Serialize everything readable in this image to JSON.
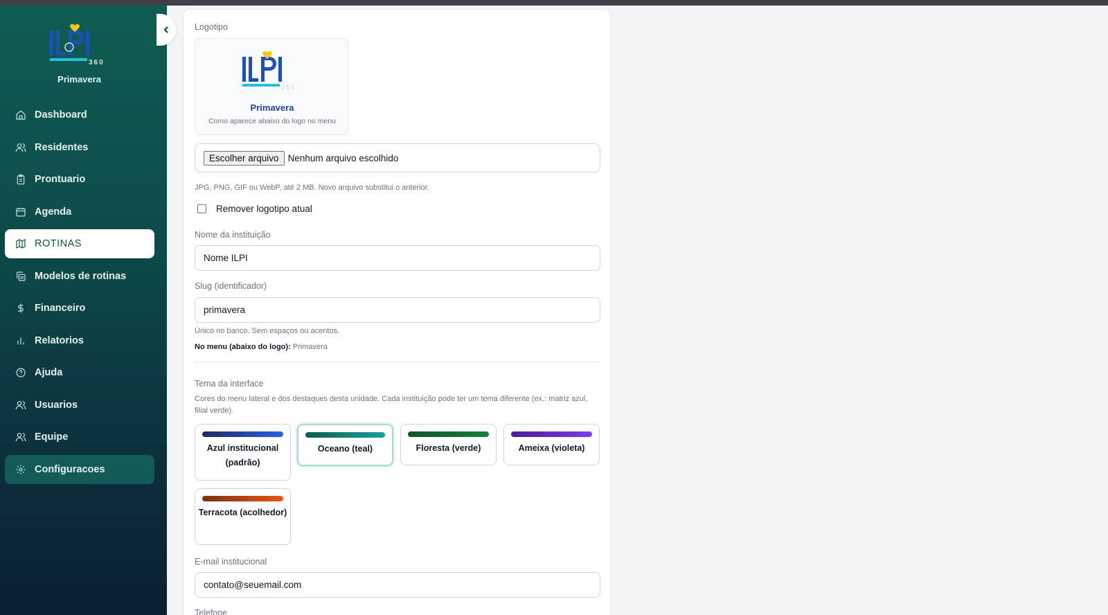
{
  "sidebar": {
    "logo_text": "ILPI",
    "logo_sub": "360",
    "org_name": "Primavera",
    "items": [
      {
        "label": "Dashboard",
        "icon": "home-icon"
      },
      {
        "label": "Residentes",
        "icon": "users-icon"
      },
      {
        "label": "Prontuario",
        "icon": "clipboard-icon"
      },
      {
        "label": "Agenda",
        "icon": "calendar-icon"
      },
      {
        "label": "ROTINAS",
        "icon": "map-icon"
      },
      {
        "label": "Modelos de rotinas",
        "icon": "copy-icon"
      },
      {
        "label": "Financeiro",
        "icon": "dollar-icon"
      },
      {
        "label": "Relatorios",
        "icon": "bar-chart-icon"
      },
      {
        "label": "Ajuda",
        "icon": "help-circle-icon"
      },
      {
        "label": "Usuarios",
        "icon": "users-icon"
      },
      {
        "label": "Equipe",
        "icon": "users-icon"
      },
      {
        "label": "Configuracoes",
        "icon": "gear-icon"
      }
    ]
  },
  "form": {
    "logo_label": "Logotipo",
    "preview_name": "Primavera",
    "preview_caption": "Como aparece abaixo do logo no menu",
    "file_button": "Escolher arquivo",
    "file_status": "Nenhum arquivo escolhido",
    "file_hint": "JPG, PNG, GIF ou WebP, até 2 MB. Novo arquivo substitui o anterior.",
    "remove_logo_label": "Remover logotipo atual",
    "name_label": "Nome da instituição",
    "name_value": "Nome ILPI",
    "slug_label": "Slug (identificador)",
    "slug_value": "primavera",
    "slug_hint": "Único no banco. Sem espaços ou acentos.",
    "menu_label": "No menu (abaixo do logo):",
    "menu_value": "Primavera",
    "theme_label": "Tema da interface",
    "theme_desc": "Cores do menu lateral e dos destaques desta unidade. Cada instituição pode ter um tema diferente (ex.: matriz azul, filial verde).",
    "themes": [
      {
        "label": "Azul institucional (padrão)",
        "from": "#1e2a5e",
        "to": "#2563eb"
      },
      {
        "label": "Oceano (teal)",
        "from": "#0f5d52",
        "to": "#14a39a"
      },
      {
        "label": "Floresta (verde)",
        "from": "#14532d",
        "to": "#15803d"
      },
      {
        "label": "Ameixa (violeta)",
        "from": "#4c1d95",
        "to": "#7c3aed"
      },
      {
        "label": "Terracota (acolhedor)",
        "from": "#7c2d12",
        "to": "#ea580c"
      }
    ],
    "selected_theme": "Oceano (teal)",
    "email_label": "E-mail institucional",
    "email_value": "contato@seuemail.com",
    "phone_label": "Telefone"
  }
}
